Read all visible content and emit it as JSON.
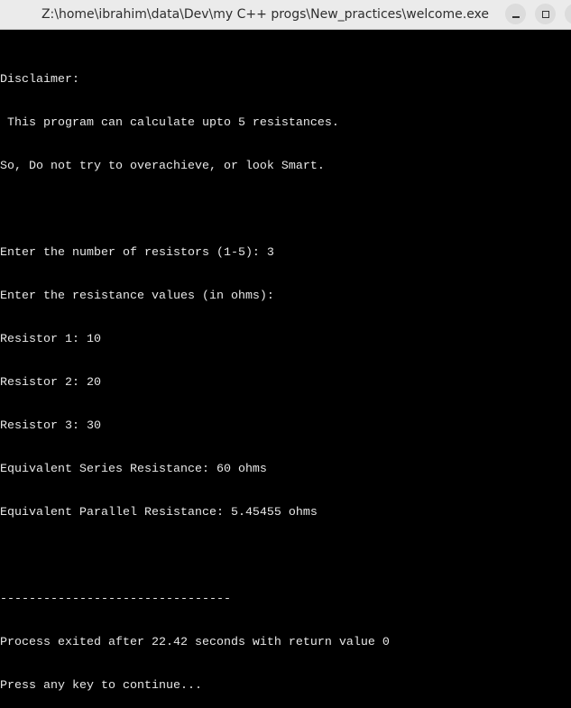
{
  "window": {
    "title": "Z:\\home\\ibrahim\\data\\Dev\\my C++ progs\\New_practices\\welcome.exe",
    "buttons": [
      "minimize-icon",
      "maximize-icon",
      "close-icon"
    ]
  },
  "console": {
    "lines": [
      "Disclaimer:",
      " This program can calculate upto 5 resistances.",
      "So, Do not try to overachieve, or look Smart.",
      "",
      "Enter the number of resistors (1-5): 3",
      "Enter the resistance values (in ohms):",
      "Resistor 1: 10",
      "Resistor 2: 20",
      "Resistor 3: 30",
      "Equivalent Series Resistance: 60 ohms",
      "Equivalent Parallel Resistance: 5.45455 ohms",
      "",
      "--------------------------------",
      "Process exited after 22.42 seconds with return value 0",
      "Press any key to continue..."
    ]
  }
}
